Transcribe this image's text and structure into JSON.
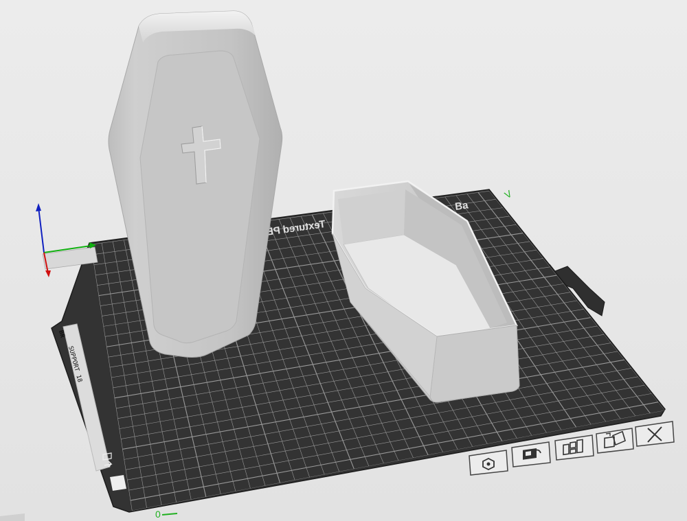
{
  "scene": {
    "plate_label": "Textured PEI Plate",
    "plate_label_prefix": "Ba",
    "plate_side_text": "BR",
    "plate_side_text_2": "SUPPORT 18",
    "axis_label_y": "V",
    "axis_label_x": "0"
  },
  "objects": [
    {
      "name": "Coffin lid"
    },
    {
      "name": "Coffin box"
    }
  ],
  "plate_buttons": [
    {
      "icon": "arrange-icon"
    },
    {
      "icon": "lock-icon"
    },
    {
      "icon": "layout-icon"
    },
    {
      "icon": "edit-plate-icon"
    },
    {
      "icon": "close-icon"
    }
  ],
  "colors": {
    "plate": "#2f2f2f",
    "grid": "#9a9a9a",
    "object": "#c8c8c8",
    "background": "#e6e6e6",
    "axis_x": "#d01010",
    "axis_y": "#10b010",
    "axis_z": "#1020c0"
  }
}
